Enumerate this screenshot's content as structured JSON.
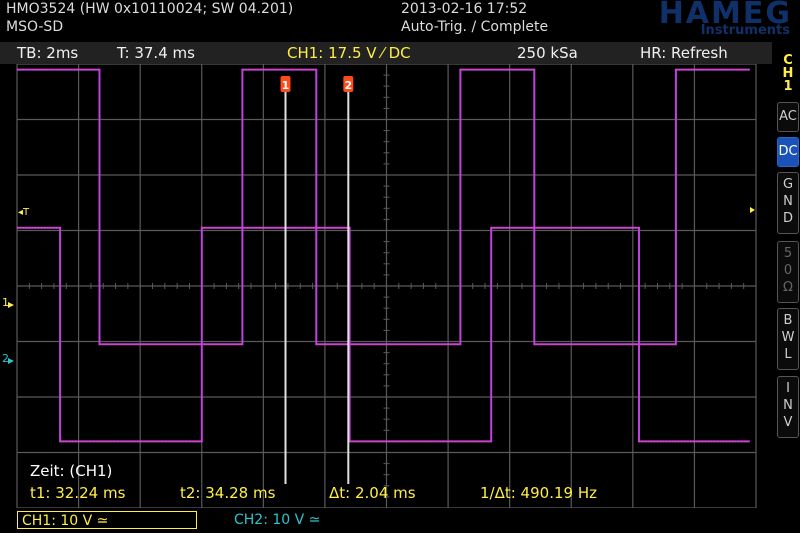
{
  "header": {
    "model_line": "HMO3524 (HW 0x10110024; SW 04.201)",
    "mode_line": "MSO-SD",
    "datetime": "2013-02-16 17:52",
    "trigger_status": "Auto-Trig. / Complete",
    "brand": "HAMEG",
    "brand_sub": "Instruments"
  },
  "status": {
    "timebase": "TB: 2ms",
    "trigger_time": "T: 37.4 ms",
    "ch1_trigger": "CH1: 17.5 V ⁄ DC",
    "sample_rate": "250 kSa",
    "hr_mode": "HR: Refresh"
  },
  "cursors": {
    "c1_label": "1",
    "c2_label": "2",
    "c1_time_ms": 32.24,
    "c2_time_ms": 34.28
  },
  "markers": {
    "trigger_marker": "◂T",
    "ch1_marker": "1",
    "ch2_marker": "2"
  },
  "readout": {
    "title": "Zeit: (CH1)",
    "t1": "t1: 32.24 ms",
    "t2": "t2: 34.28 ms",
    "dt": "Δt: 2.04 ms",
    "freq": "1/Δt: 490.19 Hz"
  },
  "sidebar": {
    "channel": "CH1",
    "buttons": [
      {
        "label": "AC",
        "active": false
      },
      {
        "label": "DC",
        "active": true
      },
      {
        "label": "GND",
        "active": false
      },
      {
        "label": "50Ω",
        "active": false
      },
      {
        "label": "BWL",
        "active": false
      },
      {
        "label": "INV",
        "active": false
      }
    ]
  },
  "footer": {
    "ch1": "CH1: 10 V ≃",
    "ch2": "CH2: 10 V ≃"
  },
  "colors": {
    "trace": "#c040e0",
    "ch1": "#ffee44",
    "ch2": "#29c6cc",
    "grid": "#5a5a5a",
    "cursor": "#e0e0e0",
    "cursor_marker": "#ff4a1a",
    "active_button": "#1b52b8",
    "brand": "#10306a"
  },
  "chart_data": {
    "type": "line",
    "xlabel": "",
    "ylabel": "",
    "series": [
      {
        "name": "CH1",
        "x": [
          0,
          2.68,
          2.68,
          7.32,
          7.32,
          9.72,
          9.72,
          14.4,
          14.4,
          16.8,
          16.8,
          21.4,
          21.4,
          23.8,
          23.8
        ],
        "values": [
          3.9,
          3.9,
          -1.05,
          -1.05,
          3.9,
          3.9,
          -1.05,
          -1.05,
          3.9,
          3.9,
          -1.05,
          -1.05,
          3.9,
          3.9,
          3.9
        ]
      },
      {
        "name": "CH2",
        "x": [
          0,
          1.4,
          1.4,
          6.0,
          6.0,
          10.8,
          10.8,
          15.4,
          15.4,
          20.2,
          20.2,
          23.8
        ],
        "values": [
          1.05,
          1.05,
          -2.8,
          -2.8,
          1.05,
          1.05,
          -2.8,
          -2.8,
          1.05,
          1.05,
          -2.8,
          -2.8
        ]
      }
    ]
  }
}
